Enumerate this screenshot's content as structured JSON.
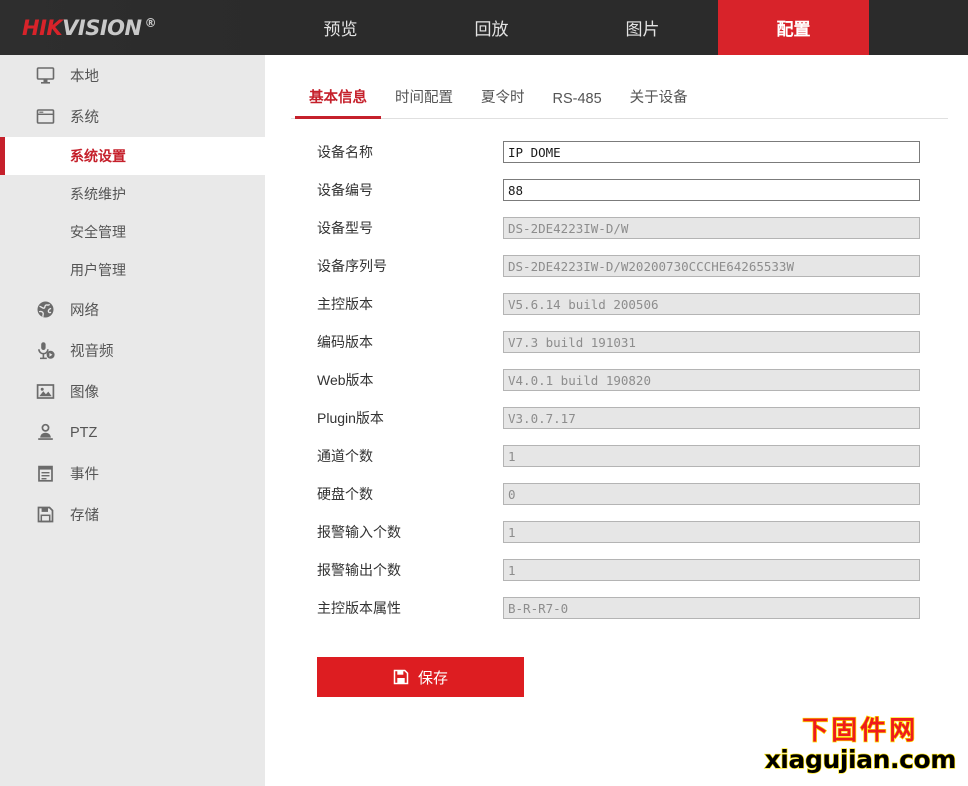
{
  "brand": {
    "logo_hik": "HIK",
    "logo_vision": "VISION",
    "logo_reg": "®"
  },
  "topnav": {
    "items": [
      {
        "label": "预览",
        "name": "nav-preview",
        "active": false
      },
      {
        "label": "回放",
        "name": "nav-playback",
        "active": false
      },
      {
        "label": "图片",
        "name": "nav-picture",
        "active": false
      },
      {
        "label": "配置",
        "name": "nav-configuration",
        "active": true
      }
    ],
    "active_color": "#d8232a"
  },
  "sidebar": {
    "groups": [
      {
        "label": "本地",
        "icon": "monitor-icon",
        "name": "sidebar-item-local",
        "children": []
      },
      {
        "label": "系统",
        "icon": "window-icon",
        "name": "sidebar-item-system",
        "children": [
          {
            "label": "系统设置",
            "name": "sidebar-subitem-system-settings",
            "active": true
          },
          {
            "label": "系统维护",
            "name": "sidebar-subitem-system-maintenance",
            "active": false
          },
          {
            "label": "安全管理",
            "name": "sidebar-subitem-security-management",
            "active": false
          },
          {
            "label": "用户管理",
            "name": "sidebar-subitem-user-management",
            "active": false
          }
        ]
      },
      {
        "label": "网络",
        "icon": "globe-icon",
        "name": "sidebar-item-network",
        "children": []
      },
      {
        "label": "视音频",
        "icon": "microphone-icon",
        "name": "sidebar-item-video-audio",
        "children": []
      },
      {
        "label": "图像",
        "icon": "image-icon",
        "name": "sidebar-item-image",
        "children": []
      },
      {
        "label": "PTZ",
        "icon": "ptz-camera-icon",
        "name": "sidebar-item-ptz",
        "children": []
      },
      {
        "label": "事件",
        "icon": "clipboard-icon",
        "name": "sidebar-item-event",
        "children": []
      },
      {
        "label": "存储",
        "icon": "floppy-disk-icon",
        "name": "sidebar-item-storage",
        "children": []
      }
    ],
    "active_color": "#c5202b"
  },
  "tabs": [
    {
      "label": "基本信息",
      "name": "tab-basic-info",
      "active": true
    },
    {
      "label": "时间配置",
      "name": "tab-time-settings",
      "active": false
    },
    {
      "label": "夏令时",
      "name": "tab-dst",
      "active": false
    },
    {
      "label": "RS-485",
      "name": "tab-rs485",
      "active": false
    },
    {
      "label": "关于设备",
      "name": "tab-about-device",
      "active": false
    }
  ],
  "form": {
    "fields": [
      {
        "label": "设备名称",
        "value": "IP DOME",
        "readonly": false,
        "name": "device-name"
      },
      {
        "label": "设备编号",
        "value": "88",
        "readonly": false,
        "name": "device-number"
      },
      {
        "label": "设备型号",
        "value": "DS-2DE4223IW-D/W",
        "readonly": true,
        "name": "device-model"
      },
      {
        "label": "设备序列号",
        "value": "DS-2DE4223IW-D/W20200730CCCHE64265533W",
        "readonly": true,
        "name": "device-serial-number"
      },
      {
        "label": "主控版本",
        "value": "V5.6.14 build 200506",
        "readonly": true,
        "name": "main-firmware-version"
      },
      {
        "label": "编码版本",
        "value": "V7.3 build 191031",
        "readonly": true,
        "name": "encoding-version"
      },
      {
        "label": "Web版本",
        "value": "V4.0.1 build 190820",
        "readonly": true,
        "name": "web-version"
      },
      {
        "label": "Plugin版本",
        "value": "V3.0.7.17",
        "readonly": true,
        "name": "plugin-version"
      },
      {
        "label": "通道个数",
        "value": "1",
        "readonly": true,
        "name": "channel-count"
      },
      {
        "label": "硬盘个数",
        "value": "0",
        "readonly": true,
        "name": "hdd-count"
      },
      {
        "label": "报警输入个数",
        "value": "1",
        "readonly": true,
        "name": "alarm-input-count"
      },
      {
        "label": "报警输出个数",
        "value": "1",
        "readonly": true,
        "name": "alarm-output-count"
      },
      {
        "label": "主控版本属性",
        "value": "B-R-R7-0",
        "readonly": true,
        "name": "main-version-attribute"
      }
    ]
  },
  "actions": {
    "save_label": "保存",
    "save_icon": "floppy-disk-icon",
    "save_color": "#dd1d21"
  },
  "watermark": {
    "chinese": "下固件网",
    "domain": "xiagujian.com",
    "chinese_color": "#ee1c1c",
    "outline_color": "#ffe400"
  }
}
